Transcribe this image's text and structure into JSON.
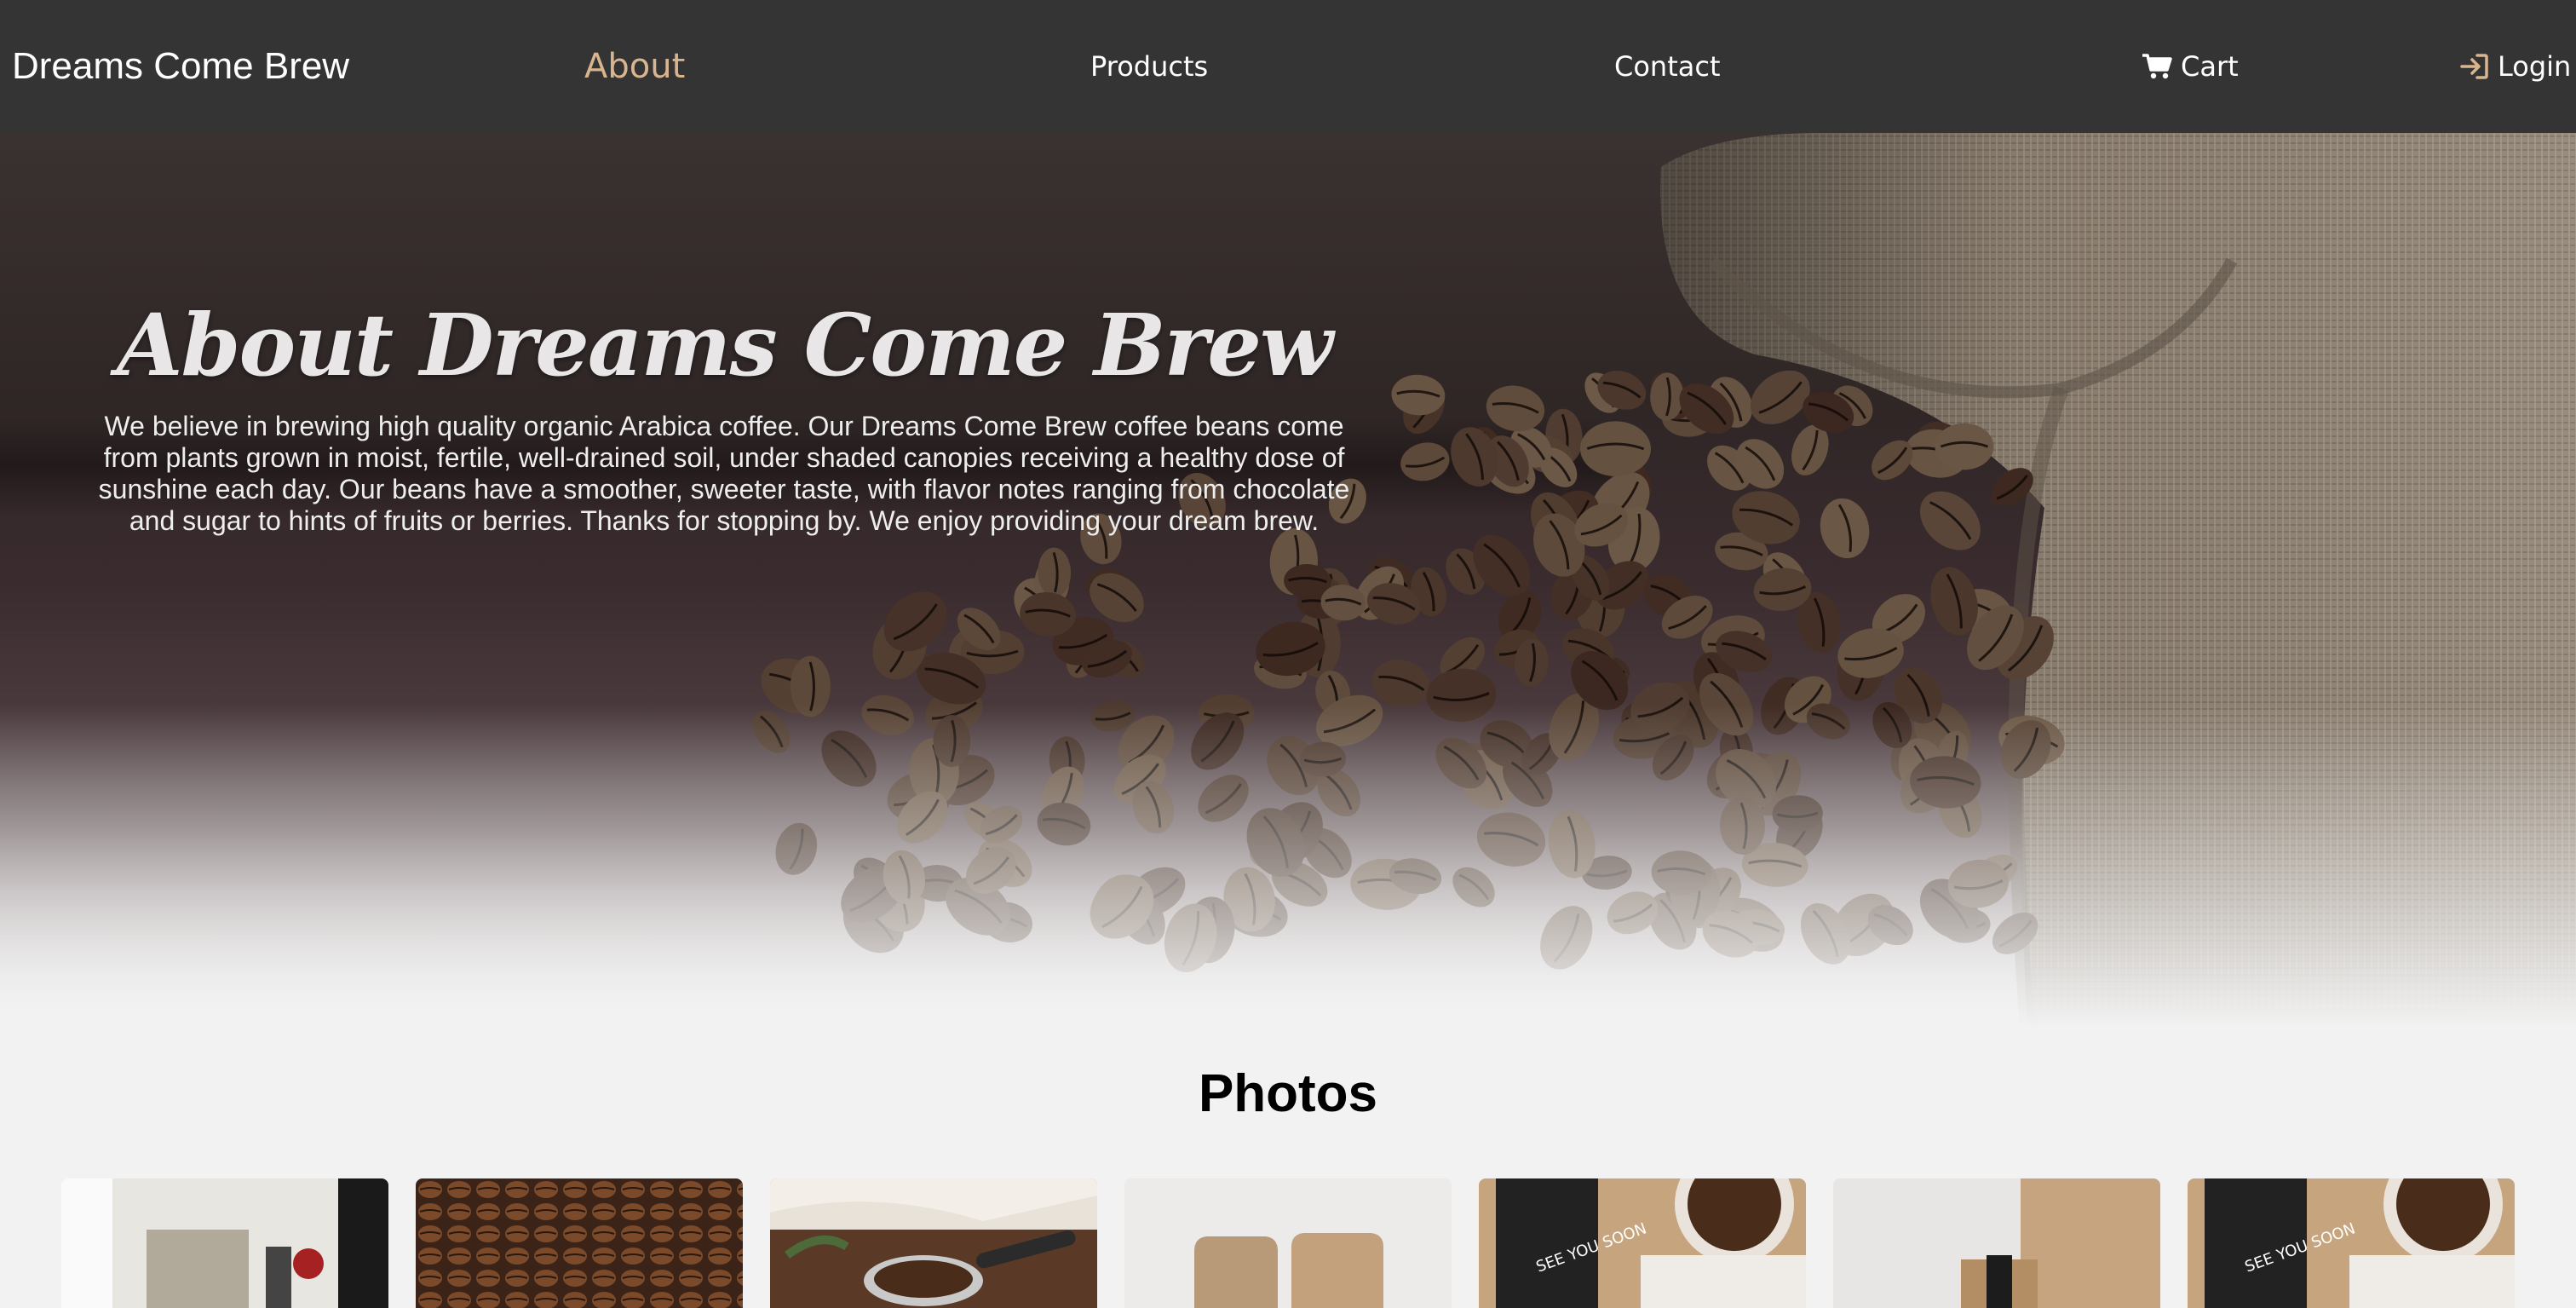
{
  "nav": {
    "brand": "Dreams Come Brew",
    "about": "About",
    "products": "Products",
    "contact": "Contact",
    "cart": "Cart",
    "login": "Login"
  },
  "hero": {
    "title": "About Dreams Come Brew",
    "text": "We believe in brewing high quality organic Arabica coffee. Our Dreams Come Brew coffee beans come from plants grown in moist, fertile, well-drained soil, under shaded canopies receiving a healthy dose of sunshine each day. Our beans have a smoother, sweeter taste, with flavor notes ranging from chocolate and sugar to hints of fruits or berries. Thanks for stopping by. We enjoy providing your dream brew."
  },
  "photos": {
    "title": "Photos",
    "thumb_text_1": "SEE YOU SOON",
    "thumb_text_2": "SEE YOU SOON"
  },
  "colors": {
    "nav_bg": "#343434",
    "accent": "#d8b58f",
    "page_bg": "#f2f2f2"
  },
  "icons": {
    "cart": "cart-icon",
    "login": "login-icon"
  }
}
